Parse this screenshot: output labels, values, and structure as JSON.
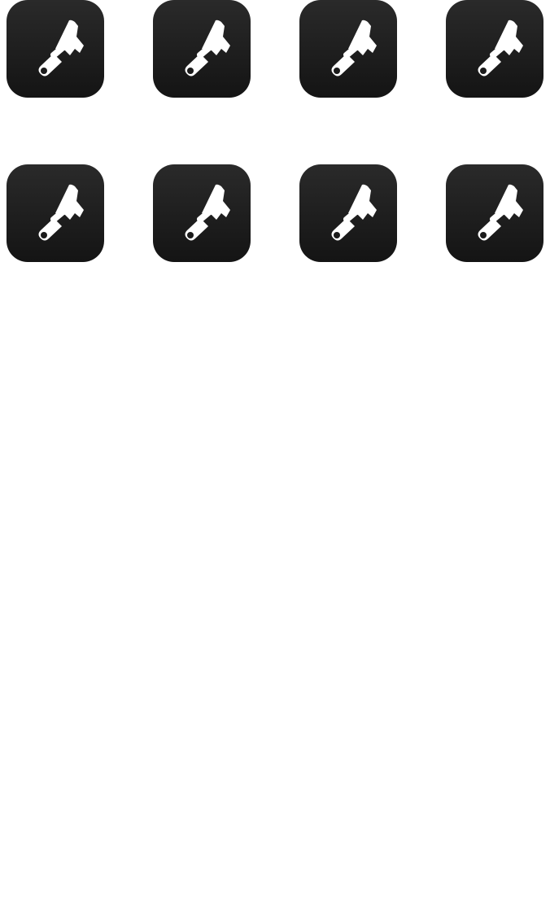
{
  "home_grid": {
    "icons": [
      {
        "name": "paintbrush-icon"
      },
      {
        "name": "paintbrush-icon"
      },
      {
        "name": "paintbrush-icon"
      },
      {
        "name": "paintbrush-icon"
      },
      {
        "name": "paintbrush-icon"
      },
      {
        "name": "paintbrush-icon"
      },
      {
        "name": "paintbrush-icon"
      },
      {
        "name": "paintbrush-icon"
      }
    ],
    "colors": {
      "tile_top": "#2a2a2a",
      "tile_bottom": "#141414",
      "glyph": "#ffffff",
      "background": "#ffffff"
    }
  }
}
